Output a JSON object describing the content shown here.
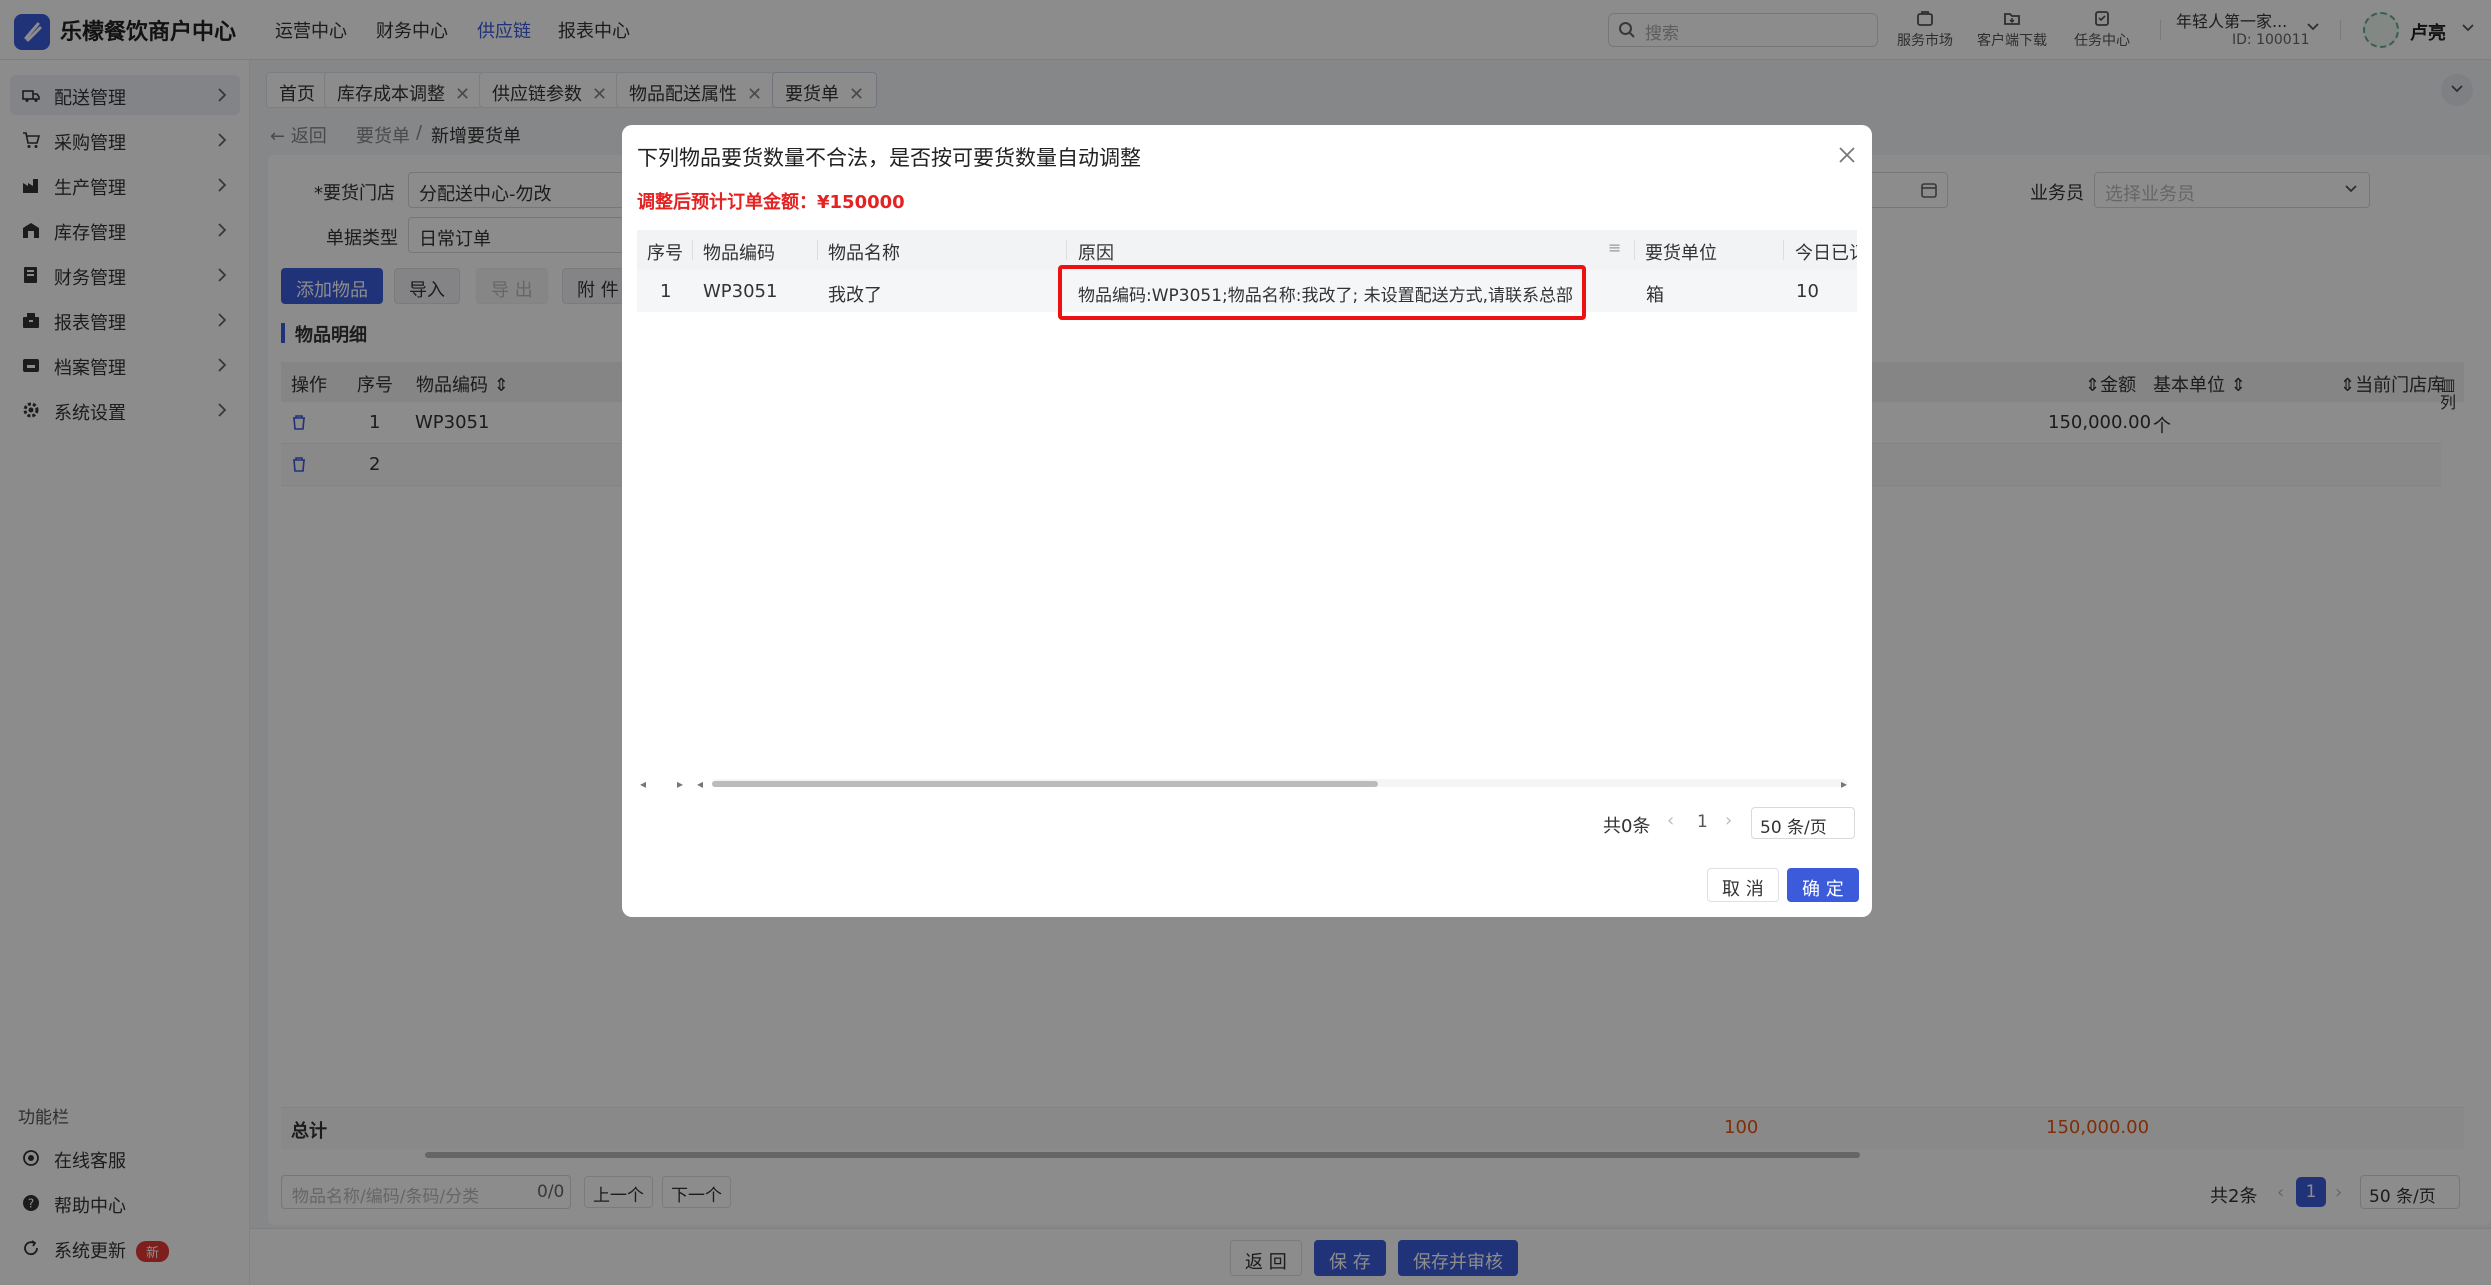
{
  "app": {
    "name": "乐檬餐饮商户中心",
    "brand_color": "#3b5bdb"
  },
  "top_nav": [
    "运营中心",
    "财务中心",
    "供应链",
    "报表中心"
  ],
  "top_nav_active": "供应链",
  "search": {
    "placeholder": "搜索"
  },
  "tools": [
    {
      "label": "服务市场",
      "icon": "store-icon"
    },
    {
      "label": "客户端下载",
      "icon": "download-icon"
    },
    {
      "label": "任务中心",
      "icon": "task-icon"
    }
  ],
  "org": {
    "name": "年轻人第一家...",
    "id": "ID: 100011"
  },
  "user": {
    "name": "卢亮"
  },
  "sidebar": {
    "items": [
      {
        "label": "配送管理",
        "icon": "truck-icon"
      },
      {
        "label": "采购管理",
        "icon": "cart-icon"
      },
      {
        "label": "生产管理",
        "icon": "factory-icon"
      },
      {
        "label": "库存管理",
        "icon": "warehouse-icon"
      },
      {
        "label": "财务管理",
        "icon": "ledger-icon"
      },
      {
        "label": "报表管理",
        "icon": "report-icon"
      },
      {
        "label": "档案管理",
        "icon": "archive-icon"
      },
      {
        "label": "系统设置",
        "icon": "gear-icon"
      }
    ],
    "func_label": "功能栏",
    "func_items": [
      {
        "label": "在线客服",
        "icon": "headset-icon"
      },
      {
        "label": "帮助中心",
        "icon": "help-icon"
      },
      {
        "label": "系统更新",
        "icon": "refresh-icon",
        "badge": "新"
      }
    ]
  },
  "tabs": [
    {
      "label": "首页",
      "closable": false
    },
    {
      "label": "库存成本调整",
      "closable": true
    },
    {
      "label": "供应链参数",
      "closable": true
    },
    {
      "label": "物品配送属性",
      "closable": true
    },
    {
      "label": "要货单",
      "closable": true
    }
  ],
  "breadcrumb": {
    "back": "返回",
    "parent": "要货单",
    "sep": "/",
    "current": "新增要货单"
  },
  "form": {
    "store_label": "*要货门店",
    "store_value": "分配送中心-勿改",
    "type_label": "单据类型",
    "type_value": "日常订单",
    "salesman_label": "业务员",
    "salesman_placeholder": "选择业务员"
  },
  "toolbar": {
    "add": "添加物品",
    "import": "导入",
    "export": "导 出",
    "attach": "附 件"
  },
  "section_title": "物品明细",
  "detail_table": {
    "headers": {
      "op": "操作",
      "seq": "序号",
      "code": "物品编码",
      "amount": "金额",
      "unit": "基本单位",
      "stock": "当前门店库"
    },
    "rows": [
      {
        "seq": "1",
        "code": "WP3051",
        "amount": "150,000.00",
        "unit": "个"
      },
      {
        "seq": "2",
        "code": "",
        "amount": "",
        "unit": ""
      }
    ],
    "total_label": "总计",
    "total_qty": "100",
    "total_amount": "150,000.00",
    "col_setting": "列"
  },
  "detail_footer": {
    "search_placeholder": "物品名称/编码/条码/分类",
    "count": "0/0",
    "prev": "上一个",
    "next": "下一个",
    "total": "共2条",
    "page": "1",
    "page_size": "50 条/页"
  },
  "bottom_actions": {
    "back": "返 回",
    "save": "保 存",
    "save_audit": "保存并审核"
  },
  "modal": {
    "title": "下列物品要货数量不合法，是否按可要货数量自动调整",
    "subtitle": "调整后预计订单金额：¥150000",
    "headers": {
      "seq": "序号",
      "code": "物品编码",
      "name": "物品名称",
      "reason": "原因",
      "unit": "要货单位",
      "today": "今日已订"
    },
    "rows": [
      {
        "seq": "1",
        "code": "WP3051",
        "name": "我改了",
        "reason": "物品编码:WP3051;物品名称:我改了; 未设置配送方式,请联系总部",
        "unit": "箱",
        "today": "10"
      }
    ],
    "pager": {
      "total": "共0条",
      "page": "1",
      "page_size": "50 条/页"
    },
    "cancel": "取 消",
    "ok": "确 定",
    "scroll_fraction": 0.55
  }
}
